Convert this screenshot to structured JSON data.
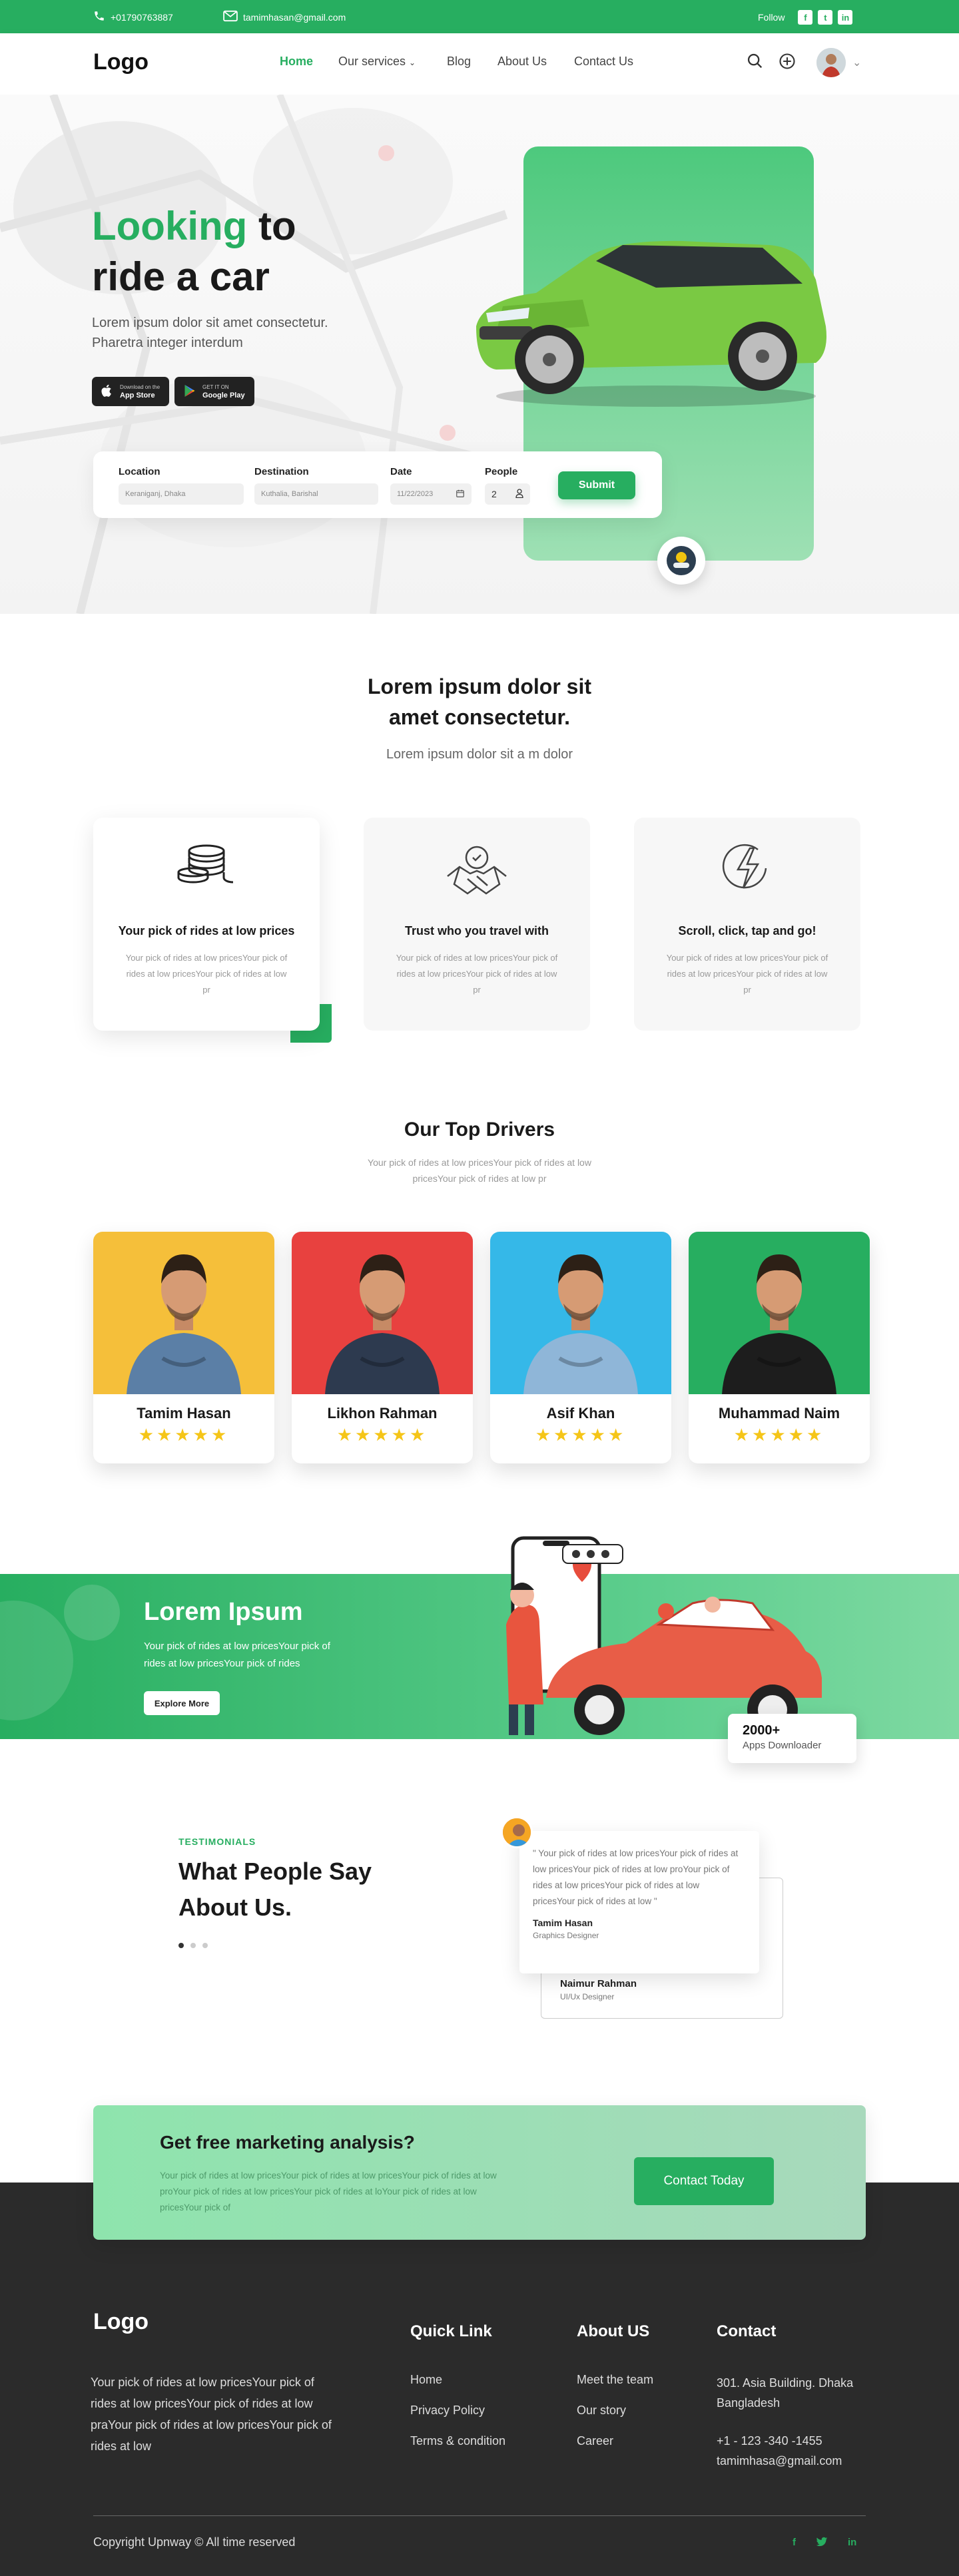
{
  "topbar": {
    "phone": "+01790763887",
    "email": "tamimhasan@gmail.com",
    "follow": "Follow"
  },
  "nav": {
    "logo": "Logo",
    "links": [
      "Home",
      "Our services",
      "Blog",
      "About Us",
      "Contact Us"
    ]
  },
  "hero": {
    "title_green": "Looking",
    "title_rest": "to",
    "title_line2": "ride a car",
    "subtitle": "Lorem ipsum dolor sit amet consectetur. Pharetra integer interdum",
    "appstore_small": "Download on the",
    "appstore": "App Store",
    "play_small": "GET IT ON",
    "play": "Google Play"
  },
  "form": {
    "location_label": "Location",
    "location_value": "Keraniganj, Dhaka",
    "destination_label": "Destination",
    "destination_value": "Kuthalia, Barishal",
    "date_label": "Date",
    "date_value": "11/22/2023",
    "people_label": "People",
    "people_value": "2",
    "submit": "Submit"
  },
  "intro": {
    "title_line1": "Lorem ipsum dolor sit",
    "title_line2": "amet consectetur.",
    "subtitle": "Lorem ipsum dolor sit a m dolor"
  },
  "features": [
    {
      "title": "Your pick of rides at low prices",
      "desc": "Your pick of rides at low pricesYour pick of rides at low pricesYour pick of rides at low pr",
      "icon": "coins-icon"
    },
    {
      "title": "Trust who you travel with",
      "desc": "Your pick of rides at low pricesYour pick of rides at low pricesYour pick of rides at low pr",
      "icon": "handshake-icon"
    },
    {
      "title": "Scroll, click, tap and go!",
      "desc": "Your pick of rides at low pricesYour pick of rides at low pricesYour pick of rides at low pr",
      "icon": "lightning-icon"
    }
  ],
  "drivers_section": {
    "title": "Our Top Drivers",
    "subtitle": "Your pick of rides at low pricesYour pick of rides at low pricesYour pick of rides at low pr"
  },
  "drivers": [
    {
      "name": "Tamim Hasan",
      "stars": "★★★★★",
      "bg": "#f5bf3a",
      "shirt": "#5b7fa6"
    },
    {
      "name": "Likhon Rahman",
      "stars": "★★★★★",
      "bg": "#e8413f",
      "shirt": "#2d3a4f"
    },
    {
      "name": "Asif Khan",
      "stars": "★★★★★",
      "bg": "#35b8e8",
      "shirt": "#8fb6d8"
    },
    {
      "name": "Muhammad  Naim",
      "stars": "★★★★★",
      "bg": "#27ae60",
      "shirt": "#1d1d1d"
    }
  ],
  "banner": {
    "title": "Lorem Ipsum",
    "text": "Your pick of rides at low pricesYour pick of rides at low pricesYour pick of rides",
    "button": "Explore More",
    "stat_value": "2000+",
    "stat_label": "Apps Downloader"
  },
  "testimonials": {
    "kicker": "TESTIMONIALS",
    "title_line1": "What People Say",
    "title_line2": "About Us.",
    "quote": "\" Your pick of rides at low pricesYour pick of rides at low pricesYour pick of rides at low proYour pick of rides at low pricesYour pick of rides at low pricesYour pick of rides at low \"",
    "author": "Tamim Hasan",
    "role": "Graphics Designer",
    "author2": "Naimur Rahman",
    "role2": "UI/Ux Designer"
  },
  "cta": {
    "title": "Get free marketing analysis?",
    "text": "Your pick of rides at low pricesYour pick of rides at low pricesYour pick of rides at low proYour pick of rides at low pricesYour pick of rides at loYour pick of rides at low pricesYour pick of",
    "button": "Contact Today"
  },
  "footer": {
    "logo": "Logo",
    "about": "Your pick of rides at low pricesYour pick of rides at low pricesYour pick of rides at low praYour pick of rides at low pricesYour pick of rides at low",
    "quick_title": "Quick Link",
    "quick": [
      "Home",
      "Privacy Policy",
      "Terms & condition"
    ],
    "about_title": "About US",
    "about_links": [
      "Meet the team",
      "Our story",
      "Career"
    ],
    "contact_title": "Contact",
    "address": "301.  Asia Building. Dhaka Bangladesh",
    "phone": "+1 - 123 -340 -1455",
    "email": "tamimhasa@gmail.com",
    "copyright": "Copyright Upnway  ©  All time reserved"
  },
  "colors": {
    "brand": "#27ae60",
    "footer_bg": "#2b2b2b",
    "star": "#f5c518"
  }
}
